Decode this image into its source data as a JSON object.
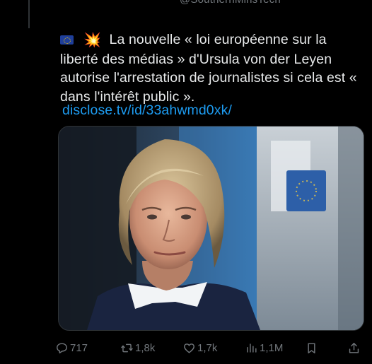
{
  "tweet": {
    "handle_partial": "@SouthernMinsTech",
    "flag_emoji": "🇪🇺",
    "burst_emoji": "💥",
    "text": "La nouvelle « loi européenne sur la liberté des médias » d'Ursula von der Leyen autorise l'arrestation de journalistes si cela est « dans l'intérêt public ».",
    "link": "disclose.tv/id/33ahwmd0xk/"
  },
  "actions": {
    "replies": "717",
    "retweets": "1,8k",
    "likes": "1,7k",
    "views": "1,1M"
  },
  "colors": {
    "background": "#000000",
    "text": "#e7e9ea",
    "muted": "#71767b",
    "link": "#1d9bf0",
    "border": "#2f3336"
  },
  "icons": [
    "reply-icon",
    "retweet-icon",
    "like-icon",
    "views-icon",
    "bookmark-icon",
    "share-icon"
  ]
}
